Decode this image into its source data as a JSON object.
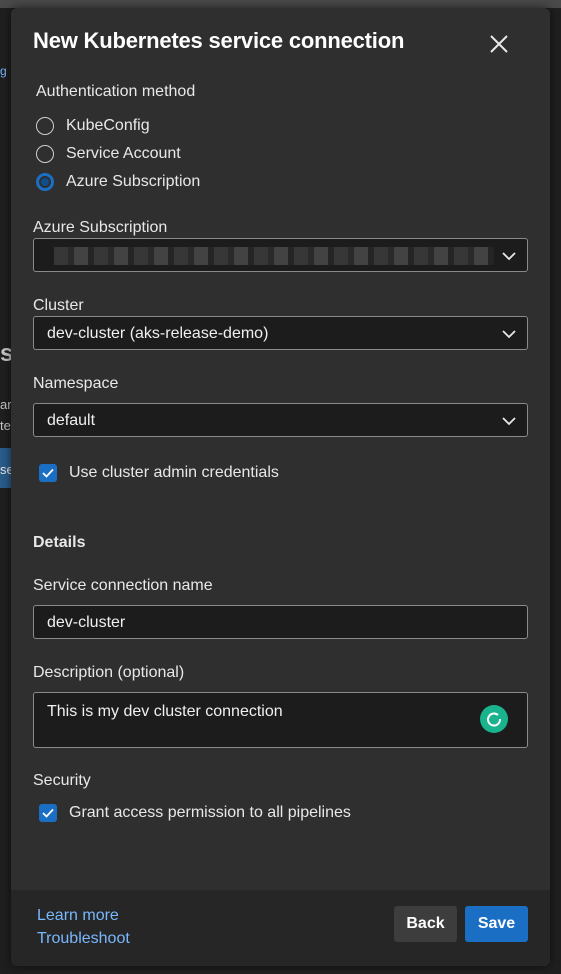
{
  "dialog": {
    "title": "New Kubernetes service connection",
    "close_icon": "close-icon"
  },
  "background": {
    "fragments": [
      "g |",
      "s",
      "ar",
      "te",
      "se"
    ]
  },
  "auth": {
    "label": "Authentication method",
    "options": [
      {
        "label": "KubeConfig",
        "checked": false
      },
      {
        "label": "Service Account",
        "checked": false
      },
      {
        "label": "Azure Subscription",
        "checked": true
      }
    ]
  },
  "subscription": {
    "label": "Azure Subscription",
    "value": ""
  },
  "cluster": {
    "label": "Cluster",
    "value": "dev-cluster (aks-release-demo)"
  },
  "namespace": {
    "label": "Namespace",
    "value": "default"
  },
  "admin_credentials": {
    "label": "Use cluster admin credentials",
    "checked": true
  },
  "details": {
    "heading": "Details",
    "name_label": "Service connection name",
    "name_value": "dev-cluster",
    "description_label": "Description (optional)",
    "description_value": "This is my dev cluster connection"
  },
  "security": {
    "label": "Security",
    "grant_label": "Grant access permission to all pipelines",
    "checked": true
  },
  "footer": {
    "learn_more": "Learn more",
    "troubleshoot": "Troubleshoot",
    "back_label": "Back",
    "save_label": "Save"
  },
  "colors": {
    "accent": "#1a6fc4",
    "link": "#79b8ff",
    "panel_bg": "#2f2f2f",
    "grammar_badge": "#19b38d"
  }
}
